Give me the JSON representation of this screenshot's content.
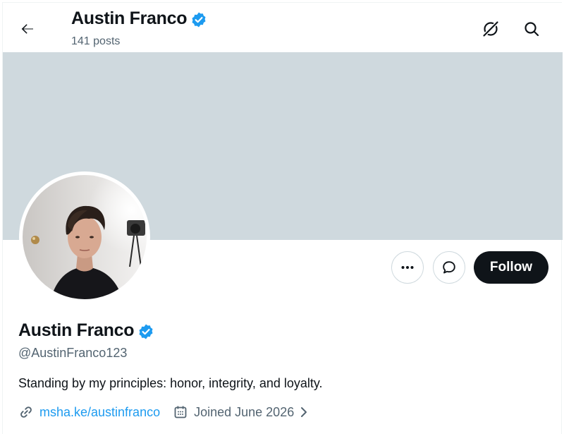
{
  "header": {
    "name": "Austin Franco",
    "posts": "141 posts"
  },
  "profile": {
    "display_name": "Austin Franco",
    "handle": "@AustinFranco123",
    "bio": "Standing by my principles: honor, integrity, and loyalty.",
    "link": "msha.ke/austinfranco",
    "joined": "Joined June 2026",
    "verified": true
  },
  "actions": {
    "follow_label": "Follow"
  },
  "icons": {
    "back": "arrow-left-icon",
    "grok": "grok-icon",
    "search": "search-icon",
    "more": "more-icon",
    "message": "message-icon",
    "verified": "verified-badge-icon",
    "link": "link-icon",
    "calendar": "calendar-icon",
    "chevron": "chevron-right-icon"
  },
  "colors": {
    "banner": "#cfd9de",
    "accent": "#1d9bf0",
    "follow_bg": "#0f1419",
    "muted_text": "#536471"
  }
}
